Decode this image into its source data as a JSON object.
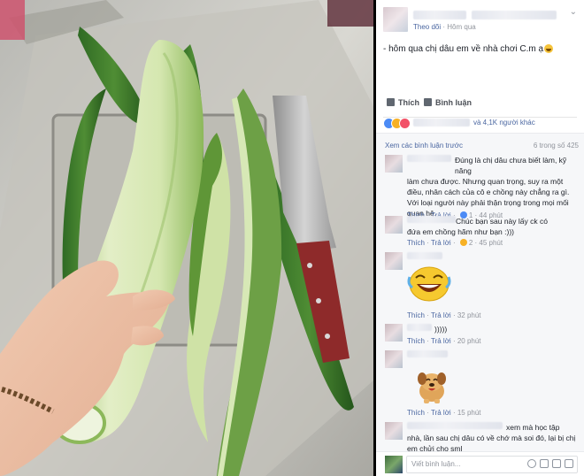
{
  "post": {
    "follow_label": "Theo dõi",
    "separator": " · ",
    "time": "Hôm qua",
    "caption": "- hôm qua chị dâu em về nhà chơi C.m ạ"
  },
  "actions": {
    "like_label": "Thích",
    "comment_label": "Bình luận"
  },
  "reactions": {
    "others_count": "và 4,1K người khác"
  },
  "comments_header": {
    "view_previous": "Xem các bình luận trước",
    "pager": "6 trong số 425"
  },
  "comments": [
    {
      "text_lines": [
        "Đúng là chị dâu chưa biết làm, kỹ năng",
        "làm chưa được. Nhưng quan trọng, suy ra một",
        "điều, nhân cách của cô e chồng này chẳng ra gì.",
        "Với loại người này phải thận trọng trong mọi mối",
        "quan hệ."
      ],
      "like": "Thích",
      "reply": "Trả lời",
      "likes": "1",
      "time": "44 phút"
    },
    {
      "text_lines": [
        "Chúc bạn sau này lấy ck có",
        "đứa em chồng hãm như bạn :)))"
      ],
      "like": "Thích",
      "reply": "Trả lời",
      "likes": "2",
      "time": "45 phút"
    },
    {
      "text_lines": [],
      "like": "Thích",
      "reply": "Trả lời",
      "time": "32 phút"
    },
    {
      "text_lines": [
        ")))))"
      ],
      "like": "Thích",
      "reply": "Trả lời",
      "time": "20 phút"
    },
    {
      "text_lines": [],
      "like": "Thích",
      "reply": "Trả lời",
      "time": "15 phút"
    },
    {
      "text_lines": [
        "xem mà học tập",
        "nhà, lần sau chị dâu có về chớ mà soi đó, lại bị chị",
        "em chửi cho sml"
      ]
    }
  ],
  "composer": {
    "placeholder": "Viết bình luận..."
  },
  "colors": {
    "link": "#4b67a1",
    "muted": "#90949c",
    "like_blue": "#4c8bf5"
  },
  "icons": [
    "like-icon",
    "comment-icon",
    "haha-reaction-icon",
    "love-reaction-icon",
    "laughing-sticker",
    "puppy-sticker",
    "emoji-icon",
    "camera-icon",
    "gif-icon",
    "sticker-icon"
  ]
}
